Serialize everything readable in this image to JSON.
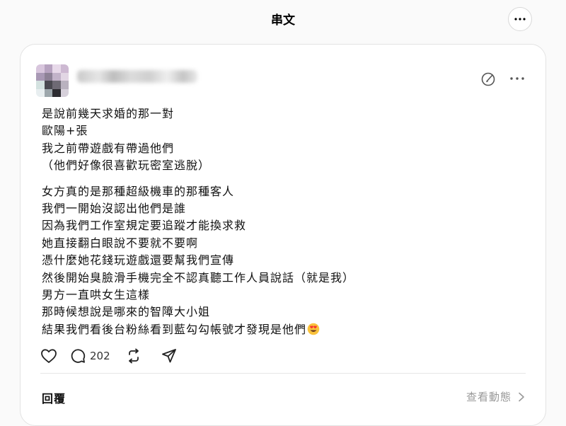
{
  "header": {
    "title": "串文",
    "more_icon": "ellipsis-icon"
  },
  "post": {
    "paragraphs": [
      [
        "是說前幾天求婚的那一對",
        "歐陽+張",
        "我之前帶遊戲有帶過他們",
        "（他們好像很喜歡玩密室逃脫）"
      ],
      [
        "女方真的是那種超級機車的那種客人",
        "我們一開始沒認出他們是誰",
        "因為我們工作室規定要追蹤才能換求救",
        "她直接翻白眼說不要就不要啊",
        "憑什麼她花錢玩遊戲還要幫我們宣傳",
        "然後開始臭臉滑手機完全不認真聽工作人員說話（就是我）",
        "男方一直哄女生這樣",
        "那時候想說是哪來的智障大小姐",
        "結果我們看後台粉絲看到藍勾勾帳號才發現是他們"
      ]
    ],
    "emoji": "heart-eyes-emoji",
    "actions": {
      "reply_count": "202"
    }
  },
  "footer": {
    "replies_label": "回覆",
    "view_activity_label": "查看動態"
  },
  "colors": {
    "background": "#fafafa",
    "card": "#ffffff",
    "muted_text": "#999999",
    "emoji_face": "#f9c23c",
    "emoji_heart": "#f8312f"
  }
}
